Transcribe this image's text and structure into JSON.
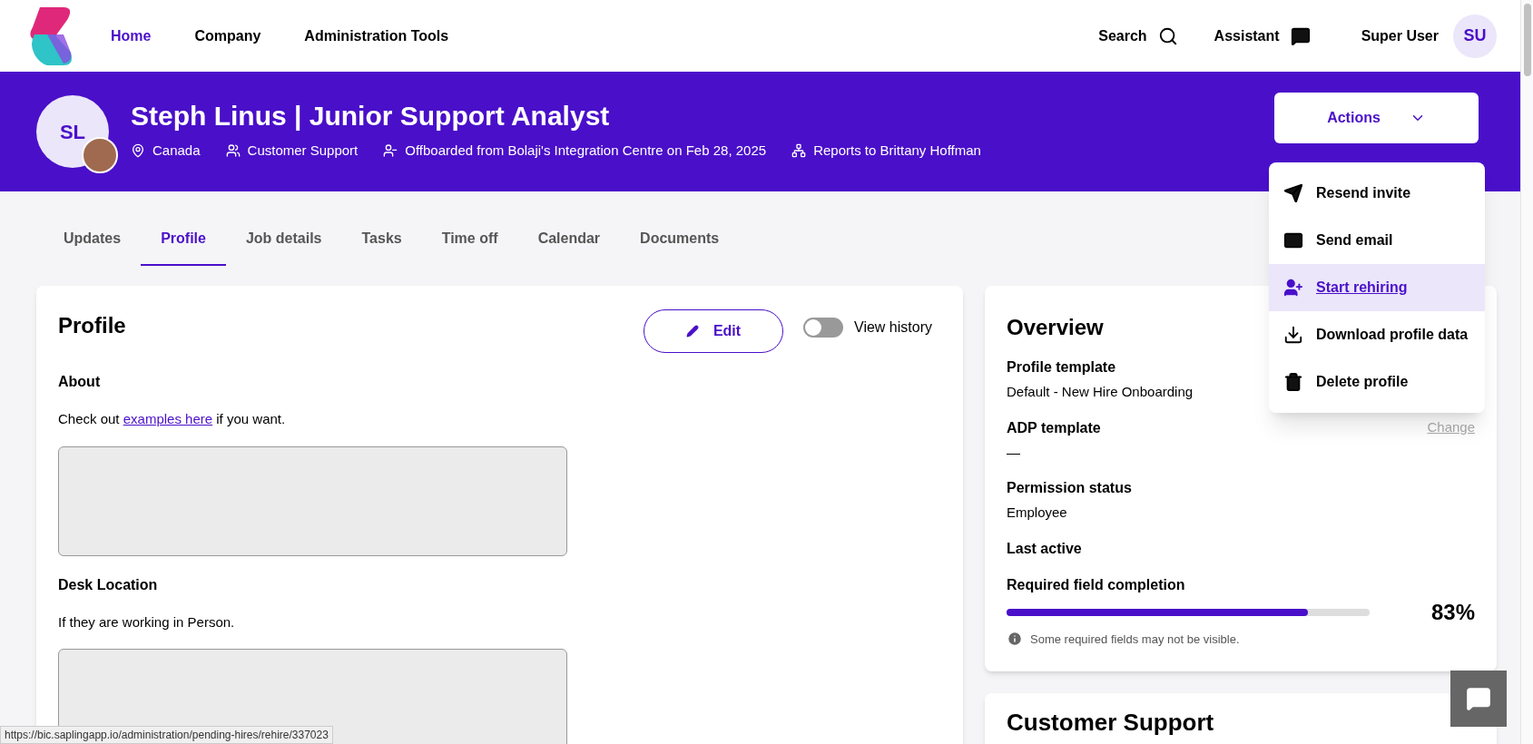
{
  "nav": {
    "items": [
      {
        "label": "Home",
        "selected": true
      },
      {
        "label": "Company",
        "selected": false
      },
      {
        "label": "Administration Tools",
        "selected": false
      }
    ],
    "search": "Search",
    "assistant": "Assistant",
    "user": {
      "name": "Super User",
      "initials": "SU"
    }
  },
  "header": {
    "initials": "SL",
    "title": "Steph Linus | Junior Support Analyst",
    "meta": [
      {
        "kind": "location",
        "text": "Canada"
      },
      {
        "kind": "team",
        "text": "Customer Support"
      },
      {
        "kind": "offboarded",
        "text": "Offboarded from Bolaji's Integration Centre on Feb 28, 2025"
      },
      {
        "kind": "manager",
        "text": "Reports to Brittany Hoffman"
      }
    ],
    "actions": {
      "label": "Actions",
      "expanded": true
    }
  },
  "actions_menu": [
    {
      "kind": "send",
      "label": "Resend invite",
      "selected": false
    },
    {
      "kind": "email",
      "label": "Send email",
      "selected": false
    },
    {
      "kind": "rehire",
      "label": "Start rehiring",
      "selected": true
    },
    {
      "kind": "download",
      "label": "Download profile data",
      "selected": false
    },
    {
      "kind": "delete",
      "label": "Delete profile",
      "selected": false
    }
  ],
  "tabs": [
    {
      "label": "Updates",
      "selected": false
    },
    {
      "label": "Profile",
      "selected": true
    },
    {
      "label": "Job details",
      "selected": false
    },
    {
      "label": "Tasks",
      "selected": false
    },
    {
      "label": "Time off",
      "selected": false
    },
    {
      "label": "Calendar",
      "selected": false
    },
    {
      "label": "Documents",
      "selected": false
    }
  ],
  "profile": {
    "title": "Profile",
    "edit": "Edit",
    "history": {
      "label": "View history",
      "on": false
    },
    "sections": [
      {
        "label": "About",
        "hint": {
          "before": "Check out ",
          "link": "examples here",
          "after": " if you want."
        }
      },
      {
        "label": "Desk Location",
        "hint": {
          "before": "If they are working in Person."
        }
      }
    ]
  },
  "overview": {
    "title": "Overview",
    "change": "Change",
    "fields": [
      {
        "label": "Profile template",
        "value": "Default - New Hire Onboarding"
      },
      {
        "label": "ADP template",
        "value": "—"
      },
      {
        "label": "Permission status",
        "value": "Employee"
      },
      {
        "label": "Last active"
      }
    ],
    "completion": {
      "label": "Required field completion",
      "level": 0.83,
      "reading": "83%",
      "note": "Some required fields may not be visible."
    }
  },
  "next_card": {
    "title": "Customer Support"
  },
  "status_url": "https://bic.saplingapp.io/administration/pending-hires/rehire/337023"
}
